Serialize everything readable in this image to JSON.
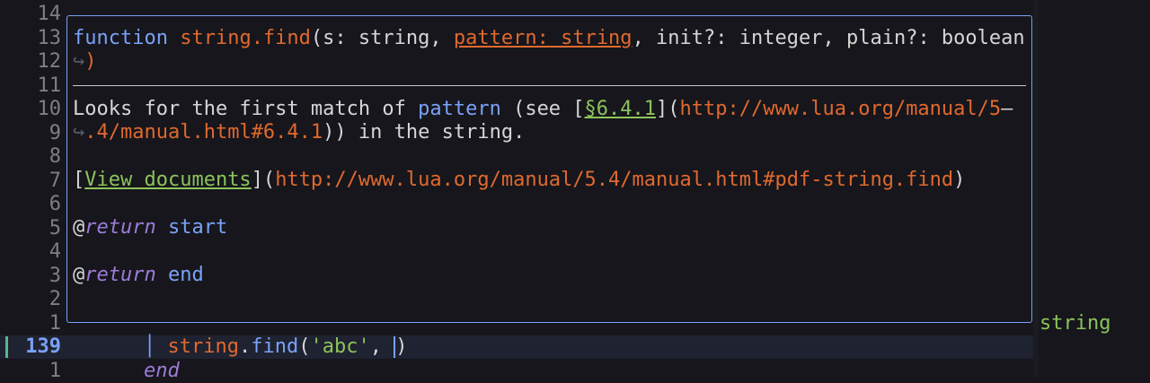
{
  "gutter": {
    "numbers": [
      "14",
      "13",
      "12",
      "11",
      "10",
      "9",
      "8",
      "7",
      "6",
      "5",
      "4",
      "3",
      "2",
      "1"
    ],
    "current": "139",
    "after": "1"
  },
  "hover": {
    "signature": {
      "keyword": "function",
      "name": "string.find",
      "open": "(s: string, ",
      "param_highlight": "pattern: string",
      "rest": ", init?: integer, plain?: boolean",
      "wrap_marker": "↪",
      "close": ")"
    },
    "desc": {
      "t1": "Looks for the first match of ",
      "pattern": "pattern",
      "t2": " (see [",
      "section": "§6.4.1",
      "t3": "](",
      "url1": "http://www.lua.org/manual/5",
      "cont_marker": "—",
      "wrap_marker": "↪",
      "url1_cont": ".4/manual.html#6.4.1",
      "t4": ")) in the string."
    },
    "doclink": {
      "open": "[",
      "text": "View documents",
      "mid": "](",
      "url": "http://www.lua.org/manual/5.4/manual.html#pdf-string.find",
      "close": ")"
    },
    "return1": {
      "at": "@",
      "tag": "return",
      "name": "start"
    },
    "return2": {
      "at": "@",
      "tag": "return",
      "name": "end"
    }
  },
  "code": {
    "current": {
      "module": "string",
      "dot": ".",
      "method": "find",
      "open": "(",
      "arg": "'abc'",
      "comma": ", ",
      "close": ")"
    },
    "next_keyword": "end"
  },
  "side_type": "string",
  "colors": {
    "accent": "#7aa2f7",
    "orange": "#e0692e",
    "green": "#8cc35a",
    "purple": "#9d7cd8",
    "background": "#16161c"
  }
}
